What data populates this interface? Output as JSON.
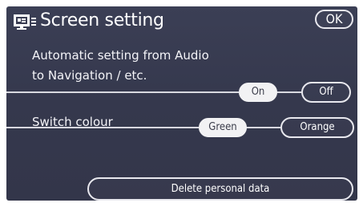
{
  "header": {
    "title": "Screen setting",
    "ok_label": "OK",
    "icon": "screen-settings-icon"
  },
  "auto_setting": {
    "label_line1": "Automatic setting from Audio",
    "label_line2": "to Navigation / etc.",
    "options": [
      "On",
      "Off"
    ],
    "selected": "On"
  },
  "switch_colour": {
    "label": "Switch colour",
    "options": [
      "Green",
      "Orange"
    ],
    "selected": "Green"
  },
  "delete_personal_data": {
    "label": "Delete personal data"
  },
  "colors": {
    "background": "#373a4f",
    "selected_fill": "#f2f2f4",
    "outline": "#e8e8ee"
  }
}
